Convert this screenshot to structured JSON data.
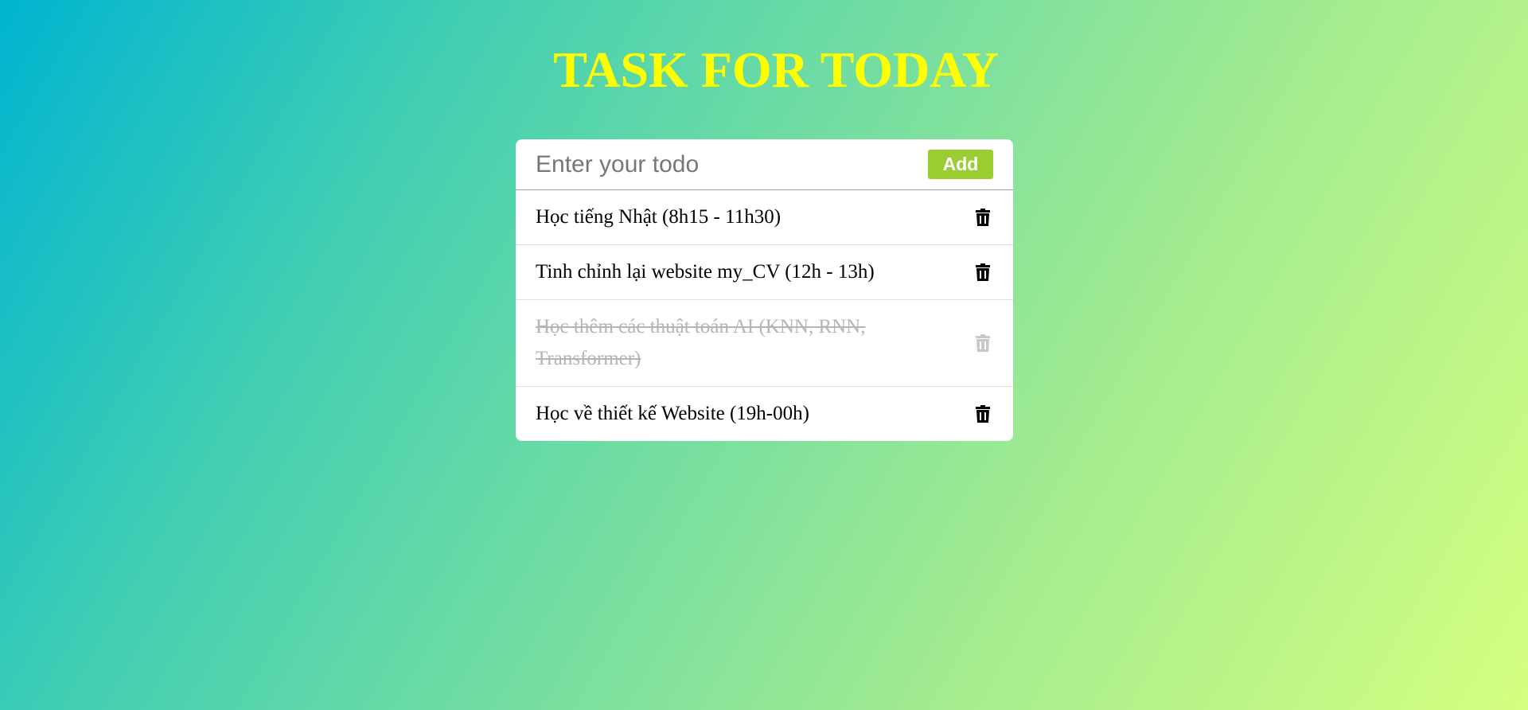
{
  "header": {
    "title": "TASK FOR TODAY"
  },
  "form": {
    "placeholder": "Enter your todo",
    "value": "",
    "add_label": "Add"
  },
  "todos": [
    {
      "text": "Học tiếng Nhật (8h15 - 11h30)",
      "completed": false
    },
    {
      "text": "Tinh chỉnh lại website my_CV (12h - 13h)",
      "completed": false
    },
    {
      "text": "Học thêm các thuật toán AI (KNN, RNN, Transformer)",
      "completed": true
    },
    {
      "text": "Học về thiết kế Website (19h-00h)",
      "completed": false
    }
  ],
  "icons": {
    "delete": "trash-icon"
  },
  "colors": {
    "title": "#ffff00",
    "add_button": "#9acd32",
    "completed_text": "#b5b5b5"
  }
}
